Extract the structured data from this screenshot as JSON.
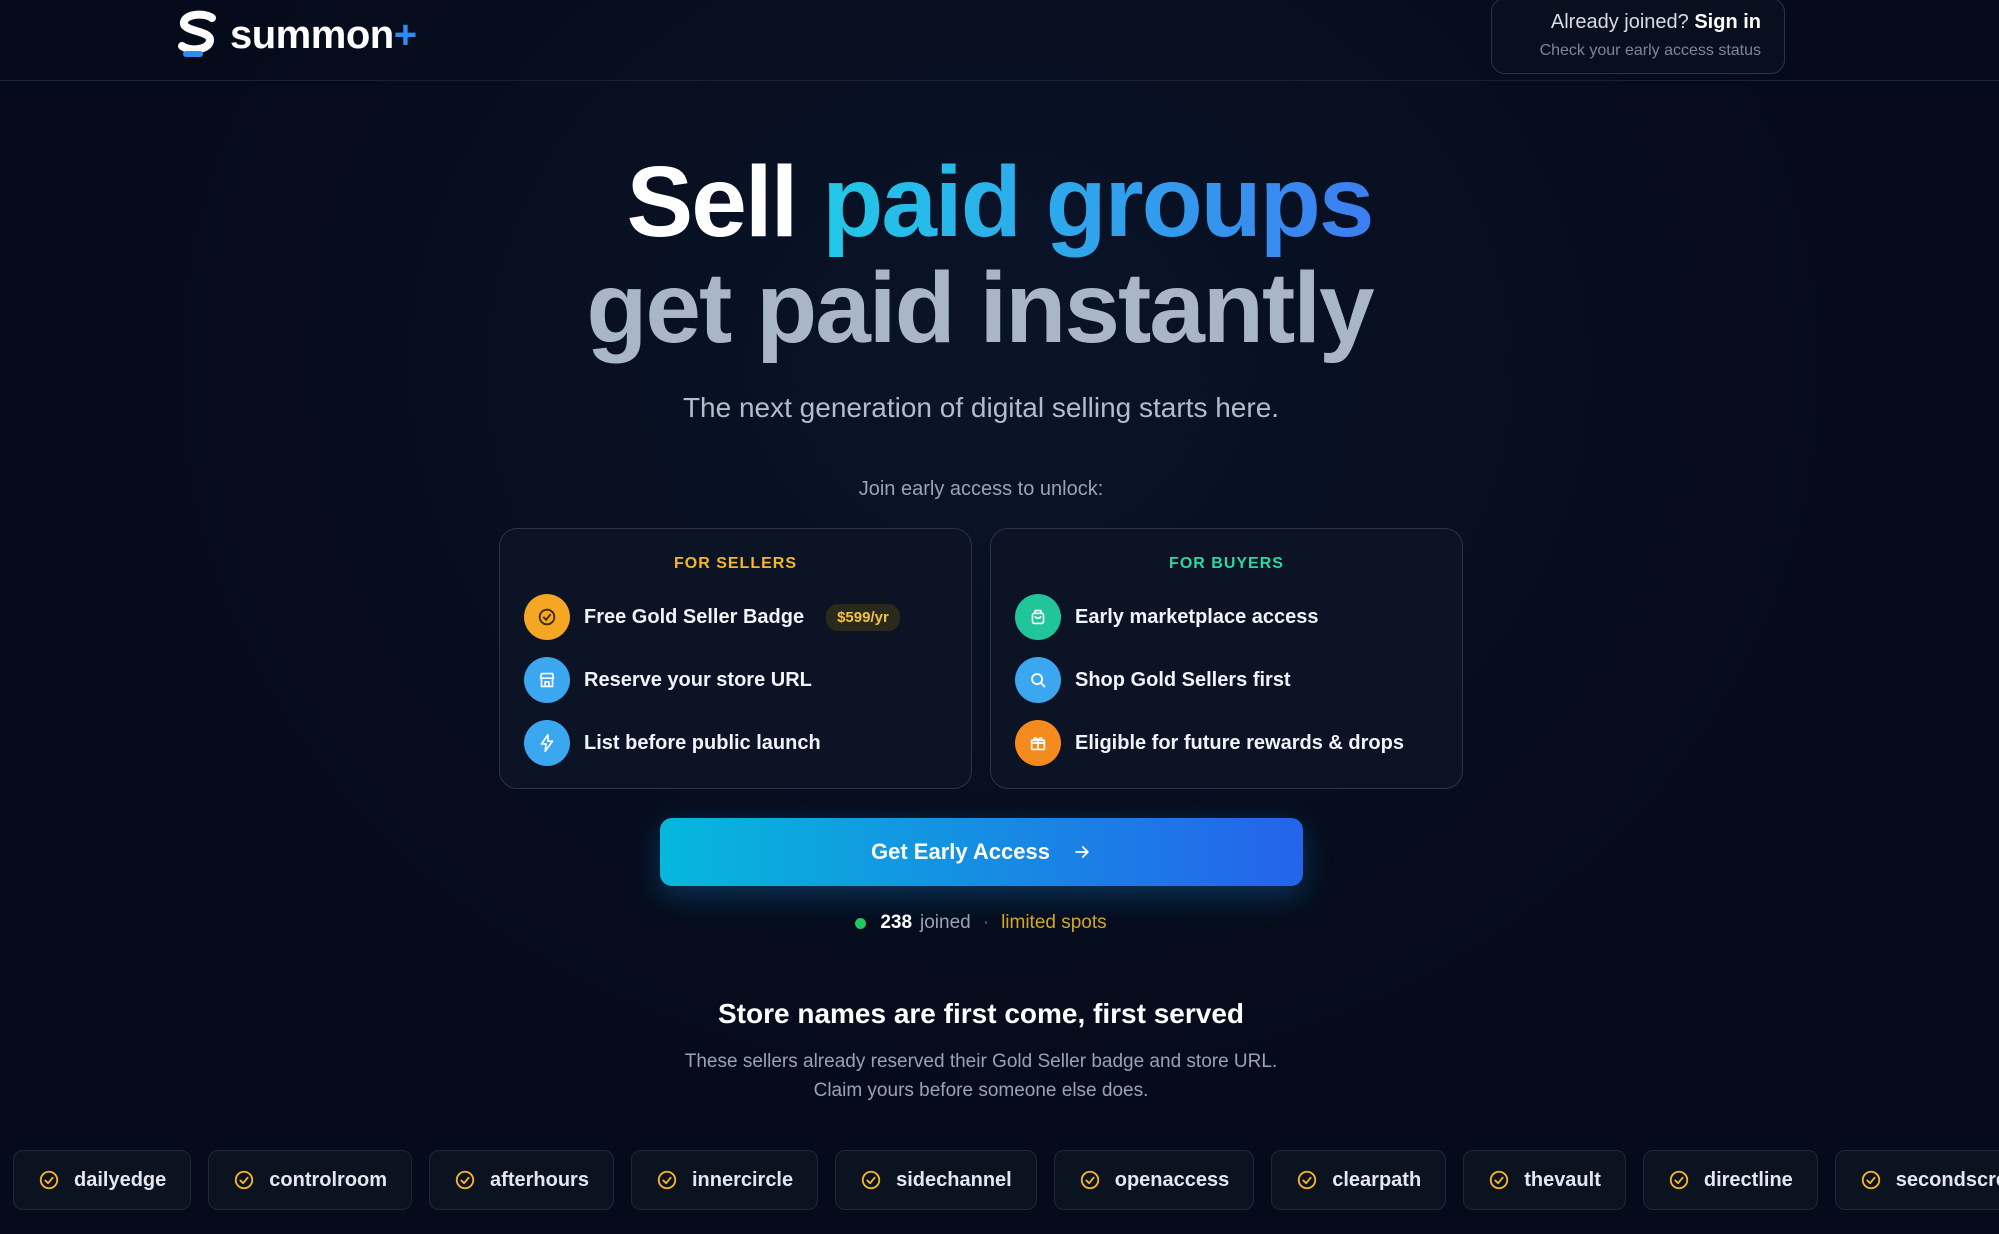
{
  "brand": {
    "name": "summon",
    "plus": "+"
  },
  "signin": {
    "prompt": "Already joined?",
    "link": "Sign in",
    "status": "Check your early access status"
  },
  "hero": {
    "line1_white": "Sell",
    "line1_gradient": "paid groups",
    "line2": "get paid instantly",
    "subtitle": "The next generation of digital selling starts here."
  },
  "unlock_label": "Join early access to unlock:",
  "sellers": {
    "title": "FOR SELLERS",
    "items": [
      {
        "label": "Free Gold Seller Badge",
        "badge": "$599/yr",
        "icon": "check-circle-icon",
        "color": "#f5a623"
      },
      {
        "label": "Reserve your store URL",
        "icon": "store-icon",
        "color": "#3ba7f0"
      },
      {
        "label": "List before public launch",
        "icon": "lightning-icon",
        "color": "#3ba7f0"
      }
    ]
  },
  "buyers": {
    "title": "FOR BUYERS",
    "items": [
      {
        "label": "Early marketplace access",
        "icon": "shopping-bag-icon",
        "color": "#21c59a"
      },
      {
        "label": "Shop Gold Sellers first",
        "icon": "search-icon",
        "color": "#3ba7f0"
      },
      {
        "label": "Eligible for future rewards & drops",
        "icon": "gift-icon",
        "color": "#f58a1f"
      }
    ]
  },
  "cta": {
    "label": "Get Early Access"
  },
  "joined": {
    "count": "238",
    "label": "joined",
    "separator": "·",
    "limited": "limited spots"
  },
  "stores": {
    "title": "Store names are first come, first served",
    "subtitle1": "These sellers already reserved their Gold Seller badge and store URL.",
    "subtitle2": "Claim yours before someone else does.",
    "chips": [
      "dailyedge",
      "controlroom",
      "afterhours",
      "innercircle",
      "sidechannel",
      "openaccess",
      "clearpath",
      "thevault",
      "directline",
      "secondscreen"
    ]
  },
  "colors": {
    "gold": "#f5b727",
    "teal": "#2fd6a0",
    "accent": "#2e8cf0"
  }
}
